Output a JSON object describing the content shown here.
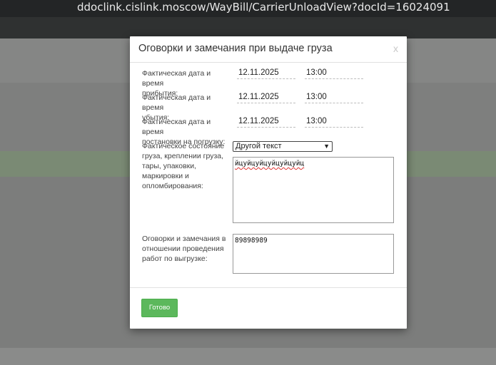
{
  "browser": {
    "url": "ddoclink.cislink.moscow/WayBill/CarrierUnloadView?docId=16024091"
  },
  "modal": {
    "title": "Оговорки и замечания при выдаче груза",
    "close_label": "x",
    "arrival": {
      "label_line1": "Фактическая дата и время",
      "label_line2": "прибытия:",
      "date": "12.11.2025",
      "time": "13:00"
    },
    "departure": {
      "label_line1": "Фактическая дата и время",
      "label_line2": "убытия:",
      "date": "12.11.2025",
      "time": "13:00"
    },
    "loading": {
      "label_line1": "Фактическая дата и время",
      "label_line2": "постановки на погрузку:",
      "date": "12.11.2025",
      "time": "13:00"
    },
    "condition": {
      "label_lines": [
        "Фактическое состояние",
        "груза, креплении груза,",
        "тары, упаковки,",
        "маркировки и",
        "опломбирования:"
      ],
      "select_value": "Другой текст",
      "text": "йцуйцуйцуйцуйцуйц"
    },
    "remarks": {
      "label_lines": [
        "Оговорки и замечания в",
        "отношении проведения",
        "работ по выгрузке:"
      ],
      "text": "89898989"
    },
    "done_label": "Готово"
  }
}
